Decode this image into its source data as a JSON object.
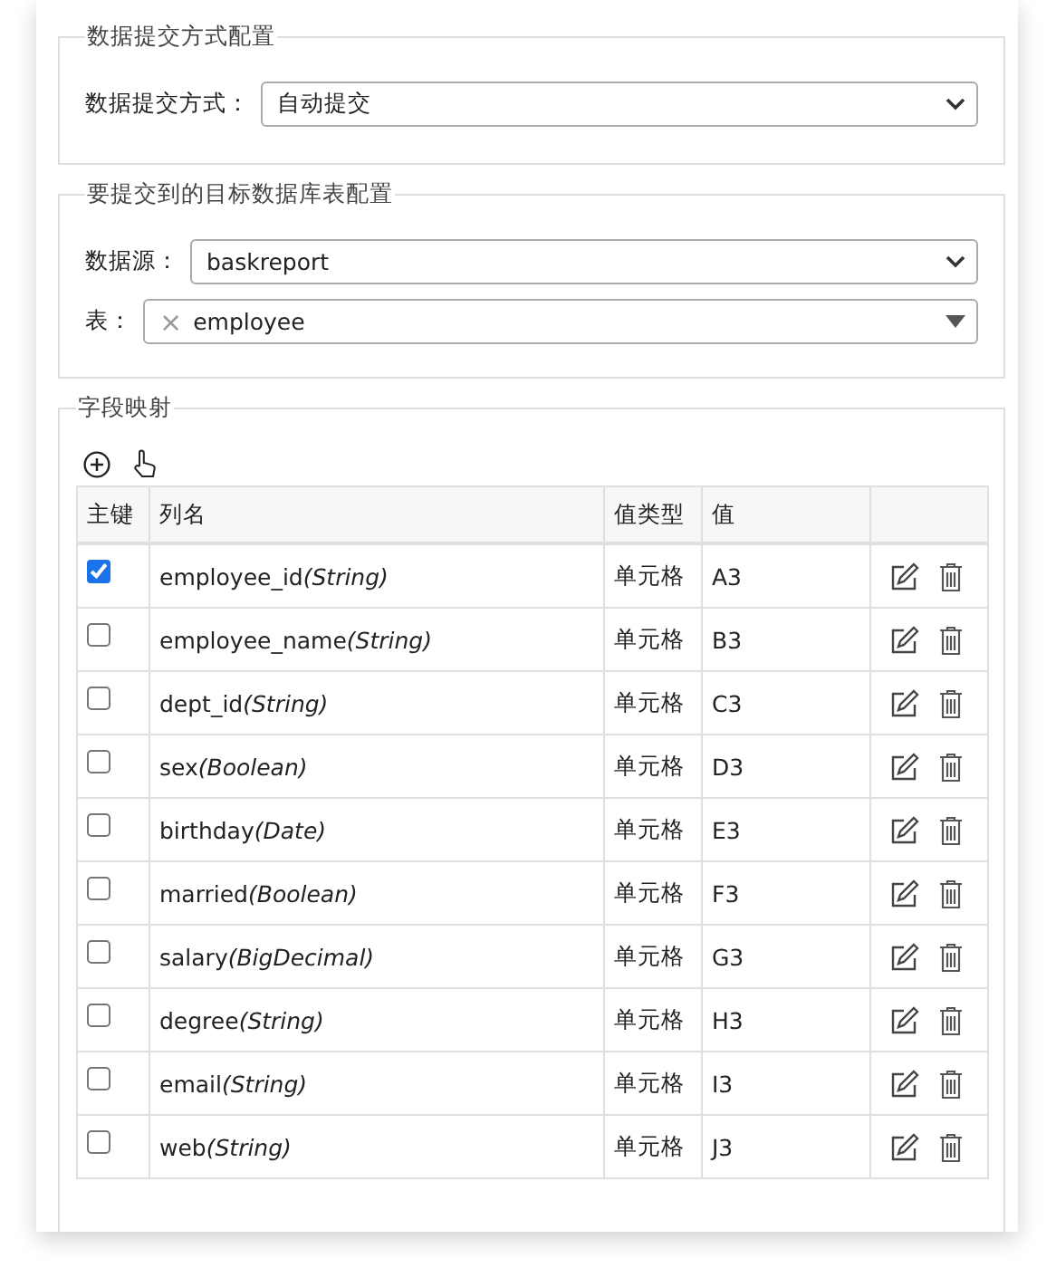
{
  "submit_config": {
    "legend": "数据提交方式配置",
    "label": "数据提交方式：",
    "value": "自动提交"
  },
  "target_config": {
    "legend": "要提交到的目标数据库表配置",
    "datasource_label": "数据源：",
    "datasource_value": "baskreport",
    "table_label": "表：",
    "table_value": "employee",
    "clear_symbol": "×"
  },
  "field_mapping": {
    "legend": "字段映射",
    "columns": [
      "主键",
      "列名",
      "值类型",
      "值",
      ""
    ],
    "rows": [
      {
        "checked": true,
        "name": "employee_id",
        "data_type": "(String)",
        "type": "单元格",
        "value": "A3"
      },
      {
        "checked": false,
        "name": "employee_name",
        "data_type": "(String)",
        "type": "单元格",
        "value": "B3"
      },
      {
        "checked": false,
        "name": "dept_id",
        "data_type": "(String)",
        "type": "单元格",
        "value": "C3"
      },
      {
        "checked": false,
        "name": "sex",
        "data_type": "(Boolean)",
        "type": "单元格",
        "value": "D3"
      },
      {
        "checked": false,
        "name": "birthday",
        "data_type": "(Date)",
        "type": "单元格",
        "value": "E3"
      },
      {
        "checked": false,
        "name": "married",
        "data_type": "(Boolean)",
        "type": "单元格",
        "value": "F3"
      },
      {
        "checked": false,
        "name": "salary",
        "data_type": "(BigDecimal)",
        "type": "单元格",
        "value": "G3"
      },
      {
        "checked": false,
        "name": "degree",
        "data_type": "(String)",
        "type": "单元格",
        "value": "H3"
      },
      {
        "checked": false,
        "name": "email",
        "data_type": "(String)",
        "type": "单元格",
        "value": "I3"
      },
      {
        "checked": false,
        "name": "web",
        "data_type": "(String)",
        "type": "单元格",
        "value": "J3"
      }
    ]
  }
}
